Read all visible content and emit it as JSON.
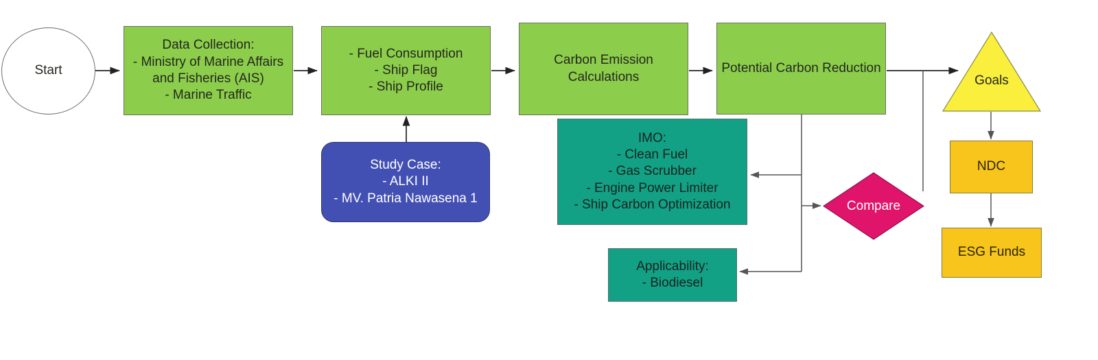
{
  "diagram": {
    "title": "Ship Carbon Emission Reduction Flowchart",
    "colors": {
      "process_green": "#8CCE4B",
      "teal": "#13A186",
      "gold": "#F7C51B",
      "triangle_yellow": "#FAEF3C",
      "diamond_crimson": "#E0146B",
      "study_case_blue": "#4350B3",
      "edge": "#3a3a3a",
      "background": "#FFFFFF"
    },
    "nodes": {
      "start": {
        "label": "Start",
        "shape": "ellipse"
      },
      "data_collection": {
        "label": "Data Collection:\n- Ministry of Marine Affairs\nand Fisheries (AIS)\n- Marine Traffic",
        "shape": "rectangle"
      },
      "ship_inputs": {
        "label": "- Fuel Consumption\n- Ship Flag\n- Ship Profile",
        "shape": "rectangle"
      },
      "carbon_calc": {
        "label": "Carbon Emission\nCalculations",
        "shape": "rectangle"
      },
      "potential_reduction": {
        "label": "Potential Carbon Reduction",
        "shape": "rectangle"
      },
      "study_case": {
        "label": "Study Case:\n- ALKI II\n- MV. Patria Nawasena 1",
        "shape": "rounded-rectangle"
      },
      "imo": {
        "label": "IMO:\n- Clean Fuel\n- Gas Scrubber\n- Engine Power Limiter\n- Ship Carbon Optimization",
        "shape": "rectangle"
      },
      "applicability": {
        "label": "Applicability:\n- Biodiesel",
        "shape": "rectangle"
      },
      "compare": {
        "label": "Compare",
        "shape": "diamond"
      },
      "goals": {
        "label": "Goals",
        "shape": "triangle"
      },
      "ndc": {
        "label": "NDC",
        "shape": "rectangle"
      },
      "esg_funds": {
        "label": "ESG Funds",
        "shape": "rectangle"
      }
    },
    "edges": [
      {
        "from": "start",
        "to": "data_collection"
      },
      {
        "from": "data_collection",
        "to": "ship_inputs"
      },
      {
        "from": "ship_inputs",
        "to": "carbon_calc"
      },
      {
        "from": "carbon_calc",
        "to": "potential_reduction"
      },
      {
        "from": "study_case",
        "to": "ship_inputs"
      },
      {
        "from": "potential_reduction",
        "to": "goals"
      },
      {
        "from": "potential_reduction",
        "to": "imo"
      },
      {
        "from": "potential_reduction",
        "to": "compare"
      },
      {
        "from": "potential_reduction",
        "to": "applicability"
      },
      {
        "from": "compare",
        "to": "goals"
      },
      {
        "from": "goals",
        "to": "ndc"
      },
      {
        "from": "ndc",
        "to": "esg_funds"
      }
    ]
  }
}
